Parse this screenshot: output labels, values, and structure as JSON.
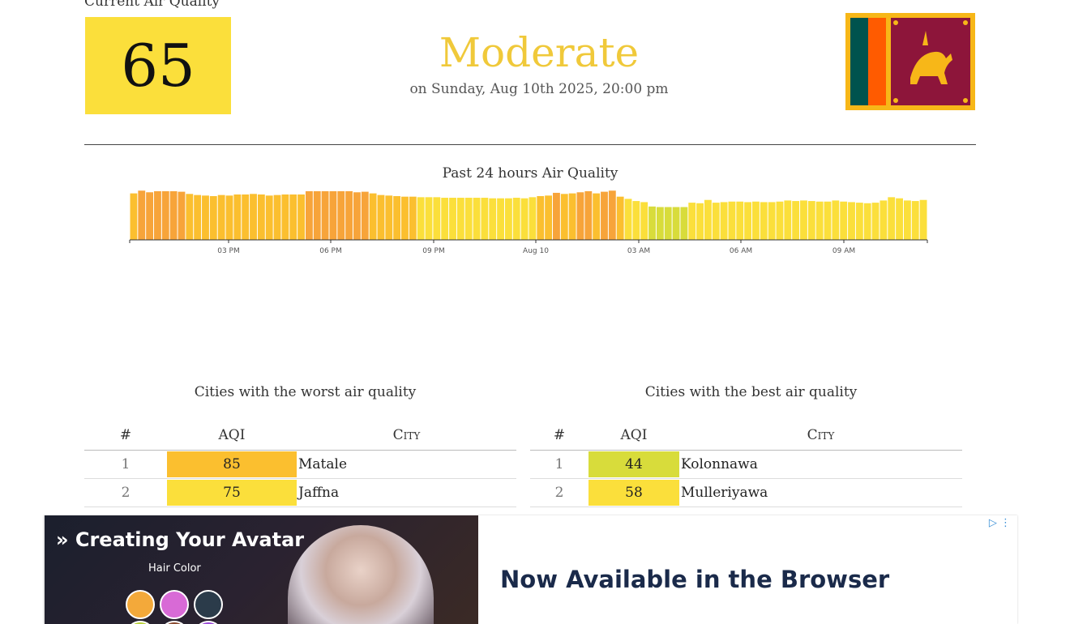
{
  "current": {
    "label": "Current Air Quality",
    "aqi": "65",
    "status": "Moderate",
    "timestamp": "on Sunday, Aug 10th 2025, 20:00 pm",
    "aqi_color": "#fbdf3b",
    "status_color": "#f0c93a"
  },
  "flag": {
    "icon": "sri-lanka-flag"
  },
  "chart_data": {
    "type": "bar",
    "title": "Past 24 hours Air Quality",
    "x_tick_labels": [
      "03 PM",
      "06 PM",
      "09 PM",
      "Aug 10",
      "03 AM",
      "06 AM",
      "09 AM"
    ],
    "values": [
      85,
      90,
      87,
      89,
      89,
      89,
      88,
      84,
      82,
      81,
      80,
      82,
      81,
      83,
      83,
      84,
      83,
      81,
      82,
      83,
      83,
      83,
      89,
      89,
      89,
      89,
      89,
      89,
      87,
      88,
      85,
      82,
      81,
      80,
      79,
      79,
      78,
      78,
      78,
      77,
      77,
      77,
      77,
      77,
      77,
      76,
      76,
      76,
      77,
      76,
      78,
      80,
      81,
      86,
      84,
      85,
      87,
      89,
      85,
      88,
      90,
      79,
      75,
      71,
      69,
      61,
      60,
      60,
      60,
      60,
      68,
      67,
      73,
      68,
      69,
      70,
      70,
      69,
      70,
      69,
      69,
      70,
      72,
      71,
      72,
      71,
      70,
      70,
      72,
      70,
      69,
      68,
      67,
      68,
      72,
      78,
      76,
      72,
      71,
      73
    ],
    "bar_colors": {
      "good_moderate": "#fbdf3b",
      "moderate_high": "#fbbf2f",
      "usg": "#f7a43a",
      "greenish": "#d8dc3b"
    },
    "ylim": [
      0,
      100
    ]
  },
  "worst": {
    "title": "Cities with the worst air quality",
    "headers": {
      "rank": "#",
      "aqi": "AQI",
      "city": "City"
    },
    "rows": [
      {
        "rank": "1",
        "aqi": "85",
        "city": "Matale",
        "color": "#fbbf2f"
      },
      {
        "rank": "2",
        "aqi": "75",
        "city": "Jaffna",
        "color": "#fbdf3b"
      }
    ]
  },
  "best": {
    "title": "Cities with the best air quality",
    "headers": {
      "rank": "#",
      "aqi": "AQI",
      "city": "City"
    },
    "rows": [
      {
        "rank": "1",
        "aqi": "44",
        "city": "Kolonnawa",
        "color": "#d8dc3b"
      },
      {
        "rank": "2",
        "aqi": "58",
        "city": "Mulleriyawa",
        "color": "#fbdf3b"
      }
    ]
  },
  "ad": {
    "headline": "Creating Your Avatar",
    "sub": "Hair Color",
    "text": "Now Available in the Browser",
    "swatches": [
      "#f3a93a",
      "#d86ad6",
      "#2b3b4a",
      "#b8d03a",
      "#8a4a2f",
      "#9a4ad6"
    ]
  }
}
